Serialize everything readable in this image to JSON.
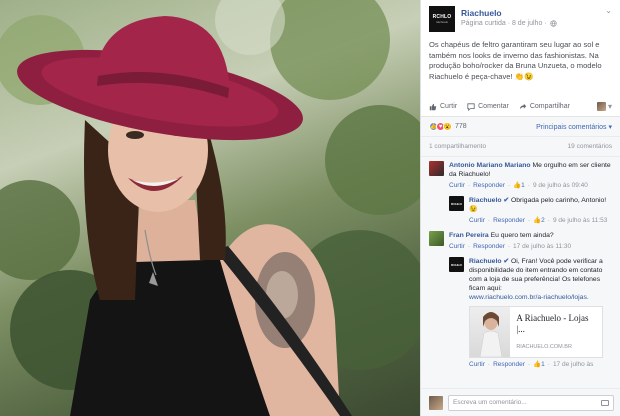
{
  "post": {
    "page_name": "Riachuelo",
    "logo_text": "RCHLO",
    "logo_sub": "riachuelo",
    "meta": "Página curtida · 8 de julho ·",
    "privacy_icon": "globe-icon",
    "text": "Os chapéus de feltro garantiram seu lugar ao sol e também nos looks de inverno das fashionistas. Na produção boho/rocker da Bruna Unzueta, o modelo Riachuelo é peça-chave! 👏😉"
  },
  "actions": {
    "like": "Curtir",
    "comment": "Comentar",
    "share": "Compartilhar"
  },
  "reactions": {
    "count": "778",
    "sort": "Principais comentários ▾"
  },
  "stats": {
    "shares": "1 compartilhamento",
    "comments": "19 comentários"
  },
  "comments": [
    {
      "author": "Antonio Mariano Mariano",
      "text": "Me orgulho em ser cliente da Riachuelo!",
      "like": "Curtir",
      "reply": "Responder",
      "likes": "1",
      "time": "9 de julho às 09:40"
    },
    {
      "author": "Riachuelo",
      "text": "Obrigada pelo carinho, Antonio!😉",
      "like": "Curtir",
      "reply": "Responder",
      "likes": "2",
      "time": "9 de julho às 11:53"
    },
    {
      "author": "Fran Pereira",
      "text": "Eu quero tem ainda?",
      "like": "Curtir",
      "reply": "Responder",
      "time": "17 de julho às 11:30"
    },
    {
      "author": "Riachuelo",
      "text": "Oi, Fran! Você pode verificar a disponibilidade do item entrando em contato com a loja de sua preferência! Os telefones ficam aqui:",
      "link": "www.riachuelo.com.br/a-riachuelo/lojas.",
      "preview_title": "A Riachuelo - Lojas |...",
      "preview_url": "RIACHUELO.COM.BR",
      "like": "Curtir",
      "reply": "Responder",
      "likes": "1",
      "time": "17 de julho às"
    }
  ],
  "composer": {
    "placeholder": "Escreva um comentário..."
  },
  "colors": {
    "link": "#365899",
    "brand_black": "#111111",
    "hat": "#a3254a"
  }
}
